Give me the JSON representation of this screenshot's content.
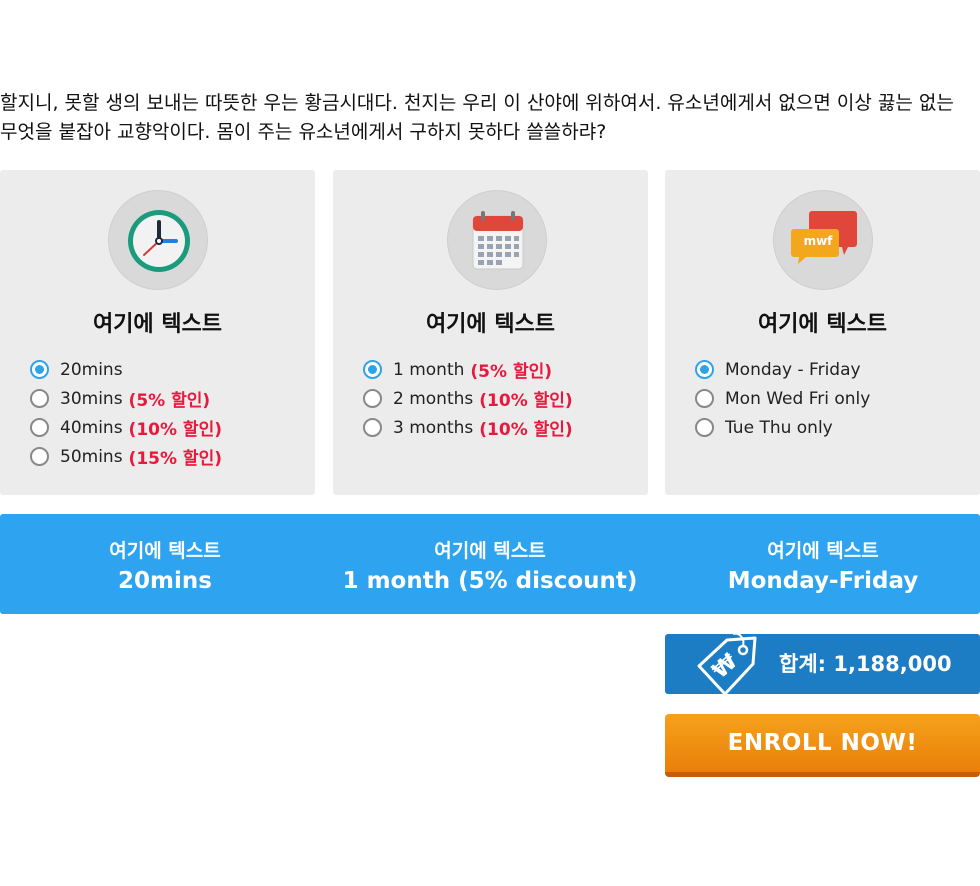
{
  "intro_text": "할지니, 못할 생의 보내는 따뜻한 우는 황금시대다. 천지는 우리 이 산야에 위하여서. 유소년에게서 없으면 이상 끓는 없는 무엇을 붙잡아 교향악이다. 몸이 주는 유소년에게서 구하지 못하다 쓸쓸하랴?",
  "cards": [
    {
      "icon": "clock-icon",
      "title": "여기에 텍스트",
      "options": [
        {
          "label": "20mins",
          "discount": "",
          "checked": true
        },
        {
          "label": "30mins",
          "discount": "(5% 할인)",
          "checked": false
        },
        {
          "label": "40mins",
          "discount": "(10% 할인)",
          "checked": false
        },
        {
          "label": "50mins",
          "discount": "(15% 할인)",
          "checked": false
        }
      ]
    },
    {
      "icon": "calendar-icon",
      "title": "여기에 텍스트",
      "options": [
        {
          "label": "1 month",
          "discount": "(5% 할인)",
          "checked": true
        },
        {
          "label": "2 months",
          "discount": "(10% 할인)",
          "checked": false
        },
        {
          "label": "3 months",
          "discount": "(10% 할인)",
          "checked": false
        }
      ]
    },
    {
      "icon": "chat-bubbles-icon",
      "icon_text": "mwf",
      "title": "여기에 텍스트",
      "options": [
        {
          "label": "Monday - Friday",
          "discount": "",
          "checked": true
        },
        {
          "label": "Mon Wed Fri only",
          "discount": "",
          "checked": false
        },
        {
          "label": "Tue Thu only",
          "discount": "",
          "checked": false
        }
      ]
    }
  ],
  "summary": [
    {
      "label": "여기에 텍스트",
      "value": "20mins"
    },
    {
      "label": "여기에 텍스트",
      "value": "1 month (5% discount)"
    },
    {
      "label": "여기에 텍스트",
      "value": "Monday-Friday"
    }
  ],
  "total": {
    "icon": "price-tag-icon",
    "tag_symbol": "₩",
    "text": "합계: 1,188,000"
  },
  "enroll_label": "ENROLL NOW!",
  "colors": {
    "accent_blue": "#2ea3ef",
    "total_blue": "#1c7dc5",
    "discount_red": "#e8193c",
    "enroll_orange": "#f5a21b",
    "card_bg": "#ececec"
  }
}
